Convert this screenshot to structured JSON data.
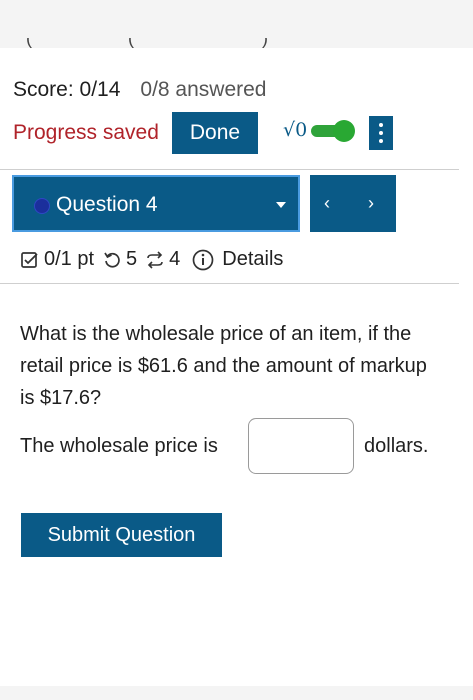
{
  "header": {
    "score": "Score: 0/14",
    "answered": "0/8 answered",
    "progress_saved": "Progress saved",
    "done_label": "Done",
    "math_toggle_symbol": "√0",
    "math_toggle_on": true,
    "accent_color": "#0a5a87",
    "toggle_color": "#29a833",
    "progress_color": "#b0232a"
  },
  "question_nav": {
    "selected": "Question 4",
    "prev_symbol": "‹",
    "next_symbol": "›"
  },
  "meta": {
    "points": "0/1 pt",
    "attempts": "5",
    "retries": "4",
    "details": "Details"
  },
  "question": {
    "text": "What is the wholesale price of an item, if the retail price is $61.6 and the amount of markup is $17.6?",
    "answer_prefix": "The wholesale price is",
    "answer_value": "",
    "answer_suffix": "dollars."
  },
  "submit_label": "Submit Question"
}
